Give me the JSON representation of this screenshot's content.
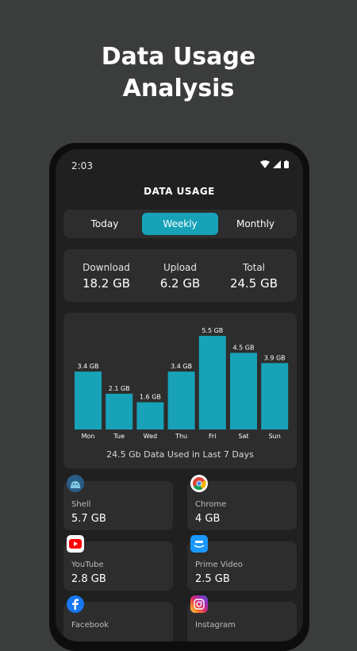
{
  "promo": {
    "line1": "Data Usage",
    "line2": "Analysis"
  },
  "status": {
    "time": "2:03"
  },
  "header": {
    "title": "DATA USAGE"
  },
  "tabs": [
    {
      "label": "Today",
      "active": false
    },
    {
      "label": "Weekly",
      "active": true
    },
    {
      "label": "Monthly",
      "active": false
    }
  ],
  "summary": [
    {
      "label": "Download",
      "value": "18.2 GB"
    },
    {
      "label": "Upload",
      "value": "6.2 GB"
    },
    {
      "label": "Total",
      "value": "24.5 GB"
    }
  ],
  "chart_data": {
    "type": "bar",
    "categories": [
      "Mon",
      "Tue",
      "Wed",
      "Thu",
      "Fri",
      "Sat",
      "Sun"
    ],
    "values": [
      3.4,
      2.1,
      1.6,
      3.4,
      5.5,
      4.5,
      3.9
    ],
    "data_labels": [
      "3.4 GB",
      "2.1 GB",
      "1.6 GB",
      "3.4 GB",
      "5.5 GB",
      "4.5 GB",
      "3.9 GB"
    ],
    "caption": "24.5 Gb Data Used in Last 7 Days",
    "bar_color": "#17a2b8",
    "grid": false
  },
  "apps": [
    {
      "name": "Shell",
      "usage": "5.7 GB",
      "icon": "android-icon"
    },
    {
      "name": "Chrome",
      "usage": "4 GB",
      "icon": "chrome-icon"
    },
    {
      "name": "YouTube",
      "usage": "2.8 GB",
      "icon": "youtube-icon"
    },
    {
      "name": "Prime Video",
      "usage": "2.5 GB",
      "icon": "prime-video-icon"
    },
    {
      "name": "Facebook",
      "usage": "",
      "icon": "facebook-icon"
    },
    {
      "name": "Instagram",
      "usage": "",
      "icon": "instagram-icon"
    }
  ],
  "colors": {
    "accent": "#17a2b8",
    "card": "#2d2d2d",
    "screen": "#202020"
  }
}
